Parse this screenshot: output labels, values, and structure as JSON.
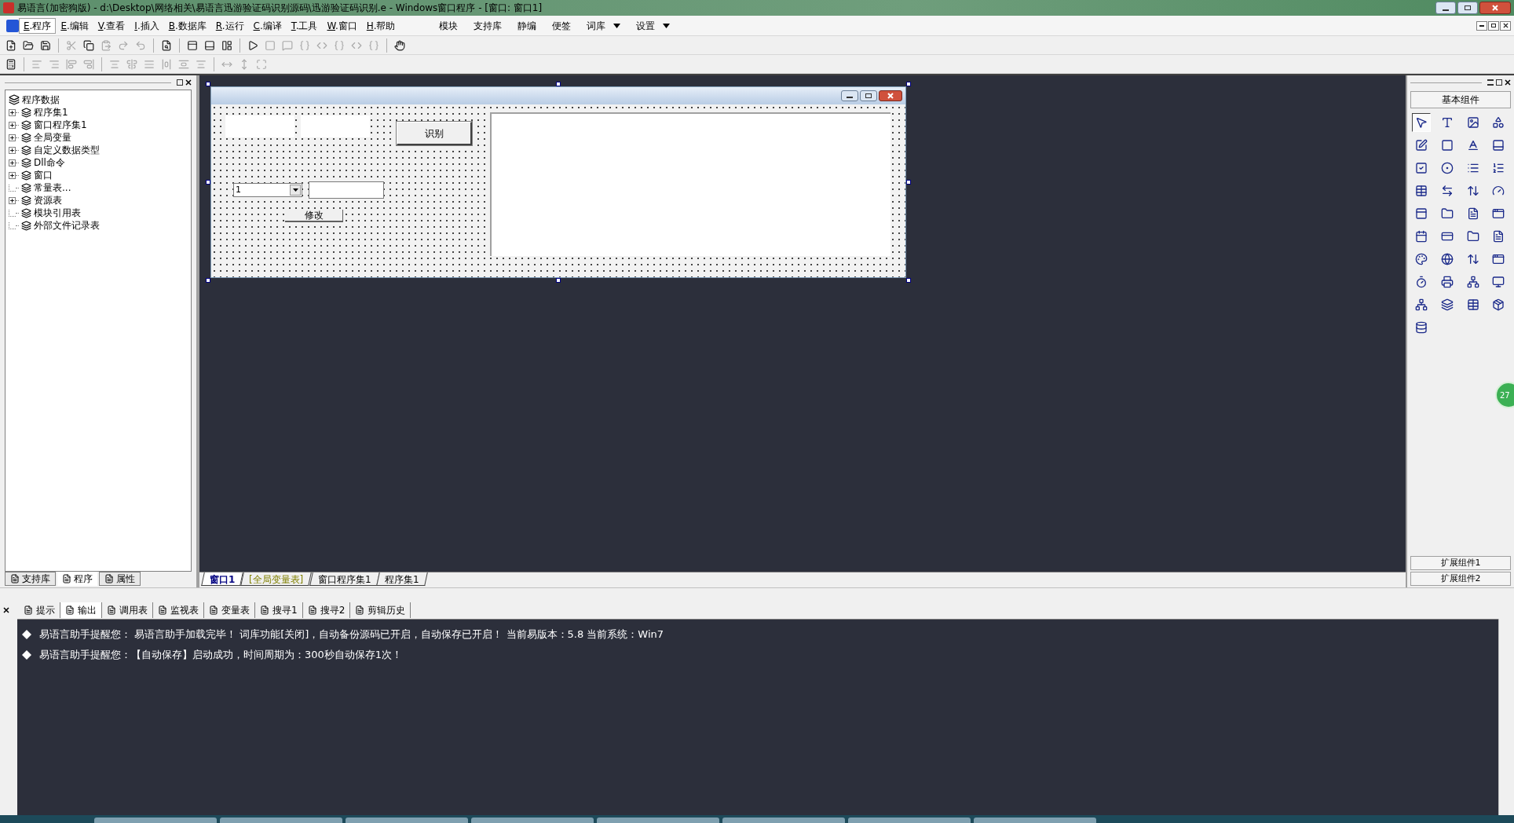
{
  "window": {
    "title": "易语言(加密狗版) - d:\\Desktop\\网络相关\\易语言迅游验证码识别源码\\迅游验证码识别.e - Windows窗口程序 - [窗口: 窗口1]"
  },
  "menu": {
    "items": [
      {
        "key": "E",
        "label": ".程序",
        "selected": true
      },
      {
        "key": "E",
        "label": ".编辑",
        "selected": false
      },
      {
        "key": "V",
        "label": ".查看",
        "selected": false
      },
      {
        "key": "I",
        "label": ".插入",
        "selected": false
      },
      {
        "key": "B",
        "label": ".数据库",
        "selected": false
      },
      {
        "key": "R",
        "label": ".运行",
        "selected": false
      },
      {
        "key": "C",
        "label": ".编译",
        "selected": false
      },
      {
        "key": "T",
        "label": ".工具",
        "selected": false
      },
      {
        "key": "W",
        "label": ".窗口",
        "selected": false
      },
      {
        "key": "H",
        "label": ".帮助",
        "selected": false
      }
    ],
    "extra_items": [
      {
        "label": "模块",
        "dropdown": false
      },
      {
        "label": "支持库",
        "dropdown": false
      },
      {
        "label": "静编",
        "dropdown": false
      },
      {
        "label": "便签",
        "dropdown": false
      },
      {
        "label": "词库",
        "dropdown": true
      },
      {
        "label": "设置",
        "dropdown": true
      }
    ]
  },
  "toolbar_1": [
    {
      "kind": "button",
      "disabled": false
    },
    {
      "kind": "button",
      "disabled": false
    },
    {
      "kind": "button",
      "disabled": false
    },
    {
      "kind": "separator"
    },
    {
      "kind": "button",
      "disabled": true
    },
    {
      "kind": "button",
      "disabled": false
    },
    {
      "kind": "button",
      "disabled": true
    },
    {
      "kind": "button",
      "disabled": true
    },
    {
      "kind": "button",
      "disabled": true
    },
    {
      "kind": "separator"
    },
    {
      "kind": "button",
      "disabled": false
    },
    {
      "kind": "separator"
    },
    {
      "kind": "button",
      "disabled": false
    },
    {
      "kind": "button",
      "disabled": false
    },
    {
      "kind": "button",
      "disabled": false
    },
    {
      "kind": "separator"
    },
    {
      "kind": "button",
      "disabled": false
    },
    {
      "kind": "button",
      "disabled": true
    },
    {
      "kind": "button",
      "disabled": true
    },
    {
      "kind": "button",
      "disabled": true
    },
    {
      "kind": "button",
      "disabled": true
    },
    {
      "kind": "button",
      "disabled": true
    },
    {
      "kind": "button",
      "disabled": true
    },
    {
      "kind": "button",
      "disabled": true
    },
    {
      "kind": "separator"
    },
    {
      "kind": "button",
      "disabled": false
    }
  ],
  "toolbar_2": [
    {
      "kind": "button",
      "disabled": false
    },
    {
      "kind": "separator"
    },
    {
      "kind": "button",
      "disabled": true
    },
    {
      "kind": "button",
      "disabled": true
    },
    {
      "kind": "button",
      "disabled": true
    },
    {
      "kind": "button",
      "disabled": true
    },
    {
      "kind": "separator"
    },
    {
      "kind": "button",
      "disabled": true
    },
    {
      "kind": "button",
      "disabled": true
    },
    {
      "kind": "button",
      "disabled": true
    },
    {
      "kind": "button",
      "disabled": true
    },
    {
      "kind": "button",
      "disabled": true
    },
    {
      "kind": "button",
      "disabled": true
    },
    {
      "kind": "separator"
    },
    {
      "kind": "button",
      "disabled": true
    },
    {
      "kind": "button",
      "disabled": true
    },
    {
      "kind": "button",
      "disabled": true
    }
  ],
  "tree": {
    "label": "程序数据",
    "children": [
      {
        "label": "程序集1",
        "expandable": true
      },
      {
        "label": "窗口程序集1",
        "expandable": true
      },
      {
        "label": "全局变量",
        "expandable": true
      },
      {
        "label": "自定义数据类型",
        "expandable": true
      },
      {
        "label": "Dll命令",
        "expandable": true
      },
      {
        "label": "窗口",
        "expandable": true
      },
      {
        "label": "常量表...",
        "expandable": false
      },
      {
        "label": "资源表",
        "expandable": true
      },
      {
        "label": "模块引用表",
        "expandable": false
      },
      {
        "label": "外部文件记录表",
        "expandable": false
      }
    ]
  },
  "left_tabs": [
    {
      "label": "支持库",
      "selected": false
    },
    {
      "label": "程序",
      "selected": true
    },
    {
      "label": "属性",
      "selected": false
    }
  ],
  "designer": {
    "recognize_button": "识别",
    "combo_value": "1",
    "modify_button": "修改"
  },
  "editor_tabs": [
    {
      "label": "窗口1",
      "selected": true,
      "color": "#000080"
    },
    {
      "label": "[全局变量表]",
      "selected": false,
      "color": "#808000"
    },
    {
      "label": "窗口程序集1",
      "selected": false,
      "color": "#000000"
    },
    {
      "label": "程序集1",
      "selected": false,
      "color": "#000000"
    }
  ],
  "palette": {
    "title": "基本组件",
    "items": [
      {
        "selected": true
      },
      {
        "selected": false
      },
      {
        "selected": false
      },
      {
        "selected": false
      },
      {
        "selected": false
      },
      {
        "selected": false
      },
      {
        "selected": false
      },
      {
        "selected": false
      },
      {
        "selected": false
      },
      {
        "selected": false
      },
      {
        "selected": false
      },
      {
        "selected": false
      },
      {
        "selected": false
      },
      {
        "selected": false
      },
      {
        "selected": false
      },
      {
        "selected": false
      },
      {
        "selected": false
      },
      {
        "selected": false
      },
      {
        "selected": false
      },
      {
        "selected": false
      },
      {
        "selected": false
      },
      {
        "selected": false
      },
      {
        "selected": false
      },
      {
        "selected": false
      },
      {
        "selected": false
      },
      {
        "selected": false
      },
      {
        "selected": false
      },
      {
        "selected": false
      },
      {
        "selected": false
      },
      {
        "selected": false
      },
      {
        "selected": false
      },
      {
        "selected": false
      },
      {
        "selected": false
      },
      {
        "selected": false
      },
      {
        "selected": false
      },
      {
        "selected": false
      },
      {
        "selected": false
      }
    ],
    "footer_buttons": [
      "扩展组件1",
      "扩展组件2"
    ],
    "badge": "27"
  },
  "output_tabs": [
    {
      "label": "提示",
      "selected": false
    },
    {
      "label": "输出",
      "selected": true
    },
    {
      "label": "调用表",
      "selected": false
    },
    {
      "label": "监视表",
      "selected": false
    },
    {
      "label": "变量表",
      "selected": false
    },
    {
      "label": "搜寻1",
      "selected": false
    },
    {
      "label": "搜寻2",
      "selected": false
    },
    {
      "label": "剪辑历史",
      "selected": false
    }
  ],
  "output_lines": [
    "易语言助手提醒您：  易语言助手加载完毕！ 词库功能[关闭]，自动备份源码已开启，自动保存已开启！ 当前易版本：5.8  当前系统：Win7",
    "易语言助手提醒您：【自动保存】启动成功，时间周期为：300秒自动保存1次！"
  ]
}
